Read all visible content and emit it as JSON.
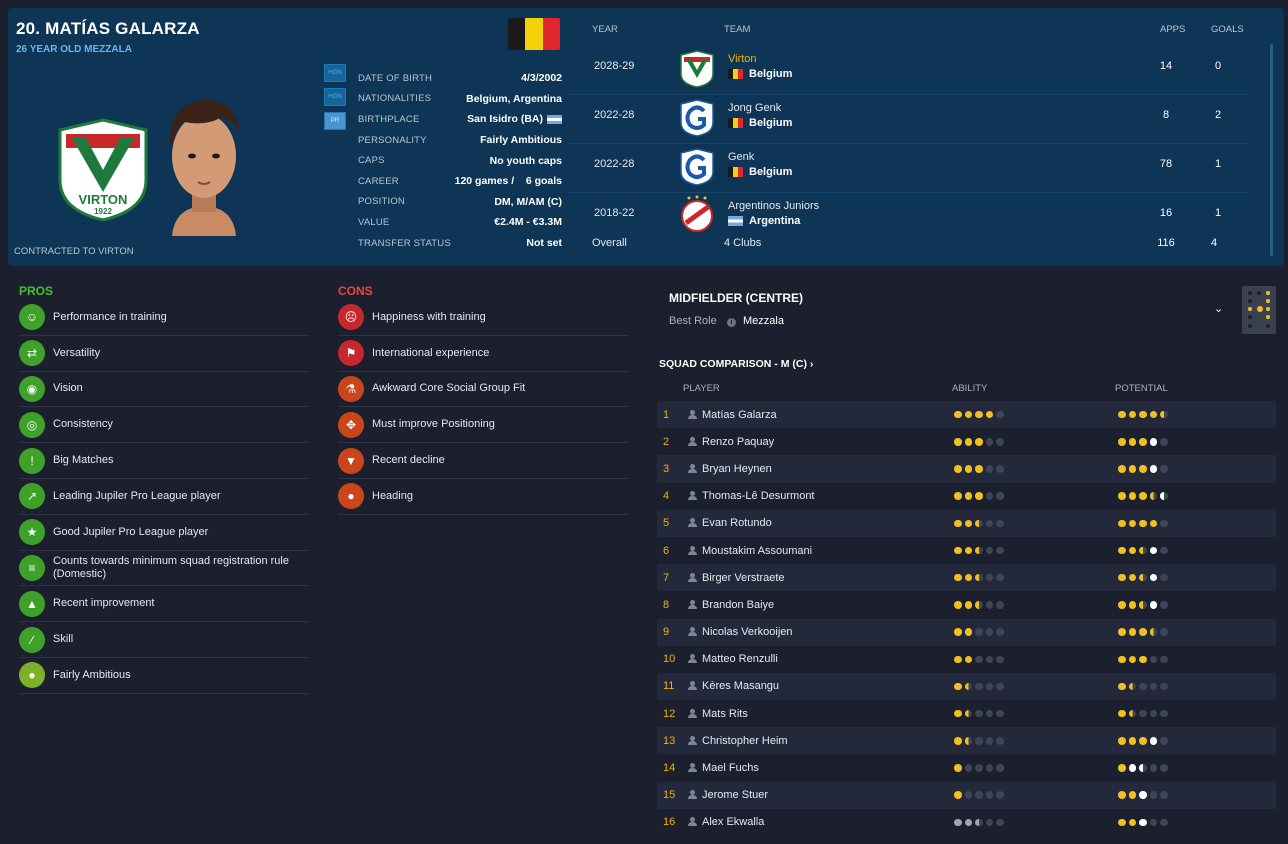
{
  "player": {
    "name": "20. MATÍAS GALARZA",
    "subtitle": "26 YEAR OLD MEZZALA",
    "contracted": "CONTRACTED TO VIRTON",
    "club_crest_text": "VIRTON",
    "club_crest_year": "1922"
  },
  "flag_colors": [
    "#1a1a1a",
    "#f5d10c",
    "#e1262d"
  ],
  "badges": [
    "HGN",
    "HGN",
    "PR"
  ],
  "details": [
    {
      "label": "DATE OF BIRTH",
      "value": "4/3/2002"
    },
    {
      "label": "NATIONALITIES",
      "value": "Belgium, Argentina"
    },
    {
      "label": "BIRTHPLACE",
      "value": "San Isidro (BA)"
    },
    {
      "label": "PERSONALITY",
      "value": "Fairly Ambitious"
    },
    {
      "label": "CAPS",
      "value": "No youth caps"
    },
    {
      "label": "CAREER",
      "value": "120 games /    6 goals"
    },
    {
      "label": "POSITION",
      "value": "DM, M/AM (C)"
    },
    {
      "label": "VALUE",
      "value": "€2.4M - €3.3M"
    },
    {
      "label": "TRANSFER STATUS",
      "value": "Not set"
    }
  ],
  "career": {
    "headers": {
      "year": "YEAR",
      "team": "TEAM",
      "apps": "APPS",
      "goals": "GOALS"
    },
    "rows": [
      {
        "year": "2028-29",
        "team": "Virton",
        "nation": "Belgium",
        "apps": "14",
        "goals": "0",
        "logo": "virton"
      },
      {
        "year": "2022-28",
        "team": "Jong Genk",
        "nation": "Belgium",
        "apps": "8",
        "goals": "2",
        "logo": "genk"
      },
      {
        "year": "2022-28",
        "team": "Genk",
        "nation": "Belgium",
        "apps": "78",
        "goals": "1",
        "logo": "genk"
      },
      {
        "year": "2018-22",
        "team": "Argentinos Juniors",
        "nation": "Argentina",
        "apps": "16",
        "goals": "1",
        "logo": "argentinos"
      }
    ],
    "overall": {
      "label": "Overall",
      "clubs": "4 Clubs",
      "apps": "116",
      "goals": "4"
    }
  },
  "pros": {
    "title": "PROS",
    "items": [
      {
        "text": "Performance in training",
        "icon": "training-icon"
      },
      {
        "text": "Versatility",
        "icon": "versatility-icon"
      },
      {
        "text": "Vision",
        "icon": "eye-icon"
      },
      {
        "text": "Consistency",
        "icon": "target-icon"
      },
      {
        "text": "Big Matches",
        "icon": "big-match-icon"
      },
      {
        "text": "Leading Jupiler Pro League player",
        "icon": "trend-up-icon"
      },
      {
        "text": "Good Jupiler Pro League player",
        "icon": "star-icon"
      },
      {
        "text": "Counts towards minimum squad registration rule (Domestic)",
        "icon": "document-icon"
      },
      {
        "text": "Recent improvement",
        "icon": "improvement-icon"
      },
      {
        "text": "Skill",
        "icon": "skill-icon"
      },
      {
        "text": "Fairly Ambitious",
        "icon": "ambition-icon"
      }
    ]
  },
  "cons": {
    "title": "CONS",
    "items": [
      {
        "text": "Happiness with training",
        "icon": "unhappy-icon"
      },
      {
        "text": "International experience",
        "icon": "flag-icon"
      },
      {
        "text": "Awkward Core Social Group Fit",
        "icon": "flask-icon"
      },
      {
        "text": "Must improve Positioning",
        "icon": "positioning-icon"
      },
      {
        "text": "Recent decline",
        "icon": "decline-icon"
      },
      {
        "text": "Heading",
        "icon": "heading-icon"
      }
    ]
  },
  "role": {
    "title": "MIDFIELDER (CENTRE)",
    "best_role_label": "Best Role",
    "best_role_value": "Mezzala"
  },
  "squad": {
    "title": "SQUAD COMPARISON - M (C)",
    "headers": {
      "player": "PLAYER",
      "ability": "ABILITY",
      "potential": "POTENTIAL"
    },
    "rows": [
      {
        "rank": "1",
        "name": "Matías Galarza",
        "ability": 4,
        "potential": 4.5,
        "potential_extra": 0
      },
      {
        "rank": "2",
        "name": "Renzo Paquay",
        "ability": 3,
        "potential": 3,
        "potential_extra": 1
      },
      {
        "rank": "3",
        "name": "Bryan Heynen",
        "ability": 3,
        "potential": 3,
        "potential_extra": 1
      },
      {
        "rank": "4",
        "name": "Thomas-Lê Desurmont",
        "ability": 3,
        "potential": 3.5,
        "potential_extra": 0.5
      },
      {
        "rank": "5",
        "name": "Evan Rotundo",
        "ability": 2.5,
        "potential": 4,
        "potential_extra": 0
      },
      {
        "rank": "6",
        "name": "Moustakim Assoumani",
        "ability": 2.5,
        "potential": 2.5,
        "potential_extra": 1
      },
      {
        "rank": "7",
        "name": "Birger Verstraete",
        "ability": 2.5,
        "potential": 2.5,
        "potential_extra": 1
      },
      {
        "rank": "8",
        "name": "Brandon Baiye",
        "ability": 2.5,
        "potential": 2.5,
        "potential_extra": 1
      },
      {
        "rank": "9",
        "name": "Nicolas Verkooijen",
        "ability": 2,
        "potential": 3.5,
        "potential_extra": 0
      },
      {
        "rank": "10",
        "name": "Matteo Renzulli",
        "ability": 2,
        "potential": 3,
        "potential_extra": 0
      },
      {
        "rank": "11",
        "name": "Kères Masangu",
        "ability": 1.5,
        "potential": 1.5,
        "potential_extra": 0
      },
      {
        "rank": "12",
        "name": "Mats Rits",
        "ability": 1.5,
        "potential": 1.5,
        "potential_extra": 0
      },
      {
        "rank": "13",
        "name": "Christopher Heim",
        "ability": 1.5,
        "potential": 3,
        "potential_extra": 1
      },
      {
        "rank": "14",
        "name": "Mael Fuchs",
        "ability": 1,
        "potential": 1,
        "potential_extra": 1.5
      },
      {
        "rank": "15",
        "name": "Jerome Stuer",
        "ability": 1,
        "potential": 2,
        "potential_extra": 1
      },
      {
        "rank": "16",
        "name": "Alex Ekwalla",
        "ability": 0,
        "ability_grey": 2.5,
        "potential": 2,
        "potential_extra": 1
      }
    ]
  }
}
